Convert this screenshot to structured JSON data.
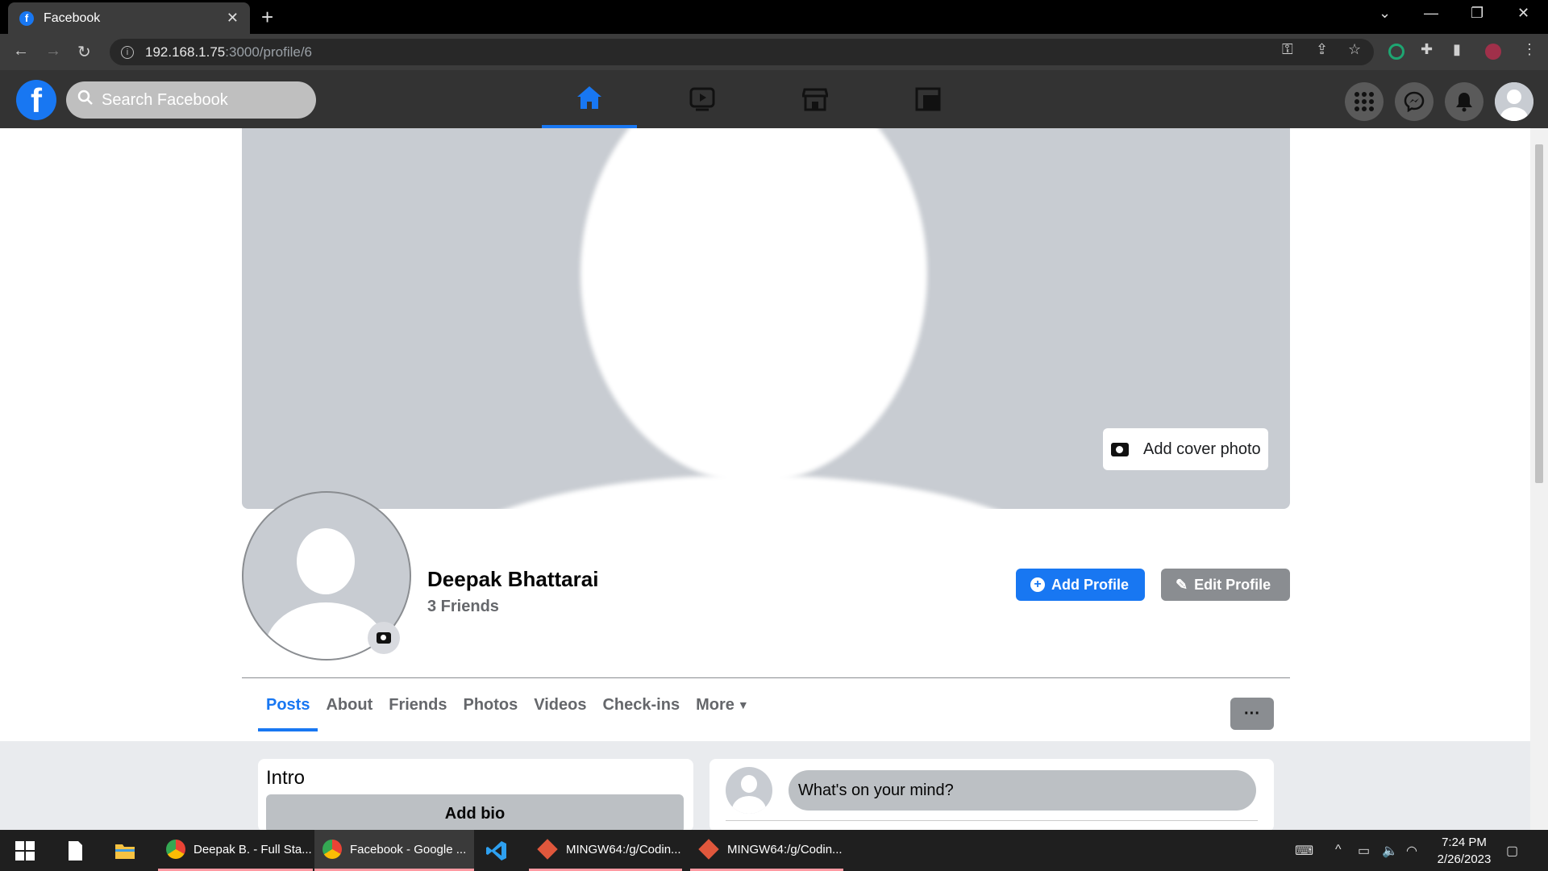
{
  "browser": {
    "tab_title": "Facebook",
    "url_host": "192.168.1.75",
    "url_rest": ":3000/profile/6"
  },
  "fb_header": {
    "logo": "f",
    "search_placeholder": "Search Facebook",
    "nav_icons": [
      "home-icon",
      "watch-icon",
      "marketplace-icon",
      "gaming-icon"
    ],
    "active_nav": "home",
    "right_icons": [
      "menu-grid-icon",
      "messenger-icon",
      "notifications-icon",
      "account-avatar-icon"
    ]
  },
  "profile": {
    "add_cover_label": "Add cover photo",
    "name": "Deepak Bhattarai",
    "friends": "3 Friends",
    "add_profile_label": "Add Profile",
    "edit_profile_label": "Edit Profile",
    "tabs": [
      "Posts",
      "About",
      "Friends",
      "Photos",
      "Videos",
      "Check-ins",
      "More"
    ],
    "active_tab": "Posts",
    "more_options_label": "···"
  },
  "intro": {
    "title": "Intro",
    "add_bio_label": "Add bio"
  },
  "composer": {
    "placeholder": "What's on your mind?"
  },
  "taskbar": {
    "apps": [
      {
        "label": "Deepak B. - Full Sta...",
        "icon": "chrome-icon"
      },
      {
        "label": "Facebook - Google ...",
        "icon": "chrome-icon"
      },
      {
        "label": "",
        "icon": "vscode-icon"
      },
      {
        "label": "MINGW64:/g/Codin...",
        "icon": "git-bash-icon"
      },
      {
        "label": "MINGW64:/g/Codin...",
        "icon": "git-bash-icon"
      }
    ],
    "time": "7:24 PM",
    "date": "2/26/2023"
  },
  "colors": {
    "fb_blue": "#1877f2",
    "header_bg": "#333333",
    "cover_bg": "#c8ccd2"
  }
}
